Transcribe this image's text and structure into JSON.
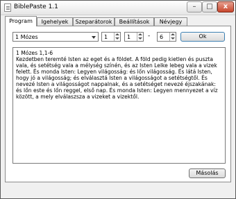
{
  "window": {
    "title": "BiblePaste 1.1",
    "min_label": "–",
    "max_label": "□",
    "close_label": "x"
  },
  "tabs": [
    "Program",
    "Igehelyek",
    "Szeparátorok",
    "Beállítások",
    "Névjegy"
  ],
  "active_tab": "Program",
  "program": {
    "book_selected": "1 Mózes",
    "chapter": "1",
    "verse_from": "1",
    "separator": "-",
    "verse_to": "6",
    "ok_label": "Ok",
    "reference": "1 Mózes 1,1-6",
    "text": "Kezdetben teremté Isten az eget és a földet. A föld pedig kietlen és puszta vala, és setétség vala a mélység színén, és az Isten Lelke lebeg vala a vizek felett. És monda Isten: Legyen világosság: és lőn világosság. És látá Isten, hogy jó a világosság; és elválasztá Isten a világosságot a setétségtől. És nevezé Isten a világosságot nappalnak, és a setétséget nevezé éjszakának: és lőn este és lőn reggel, első nap. És monda Isten: Legyen mennyezet a víz között, a mely elválaszsza a vizeket a vizektől.",
    "copy_label": "Másolás"
  }
}
